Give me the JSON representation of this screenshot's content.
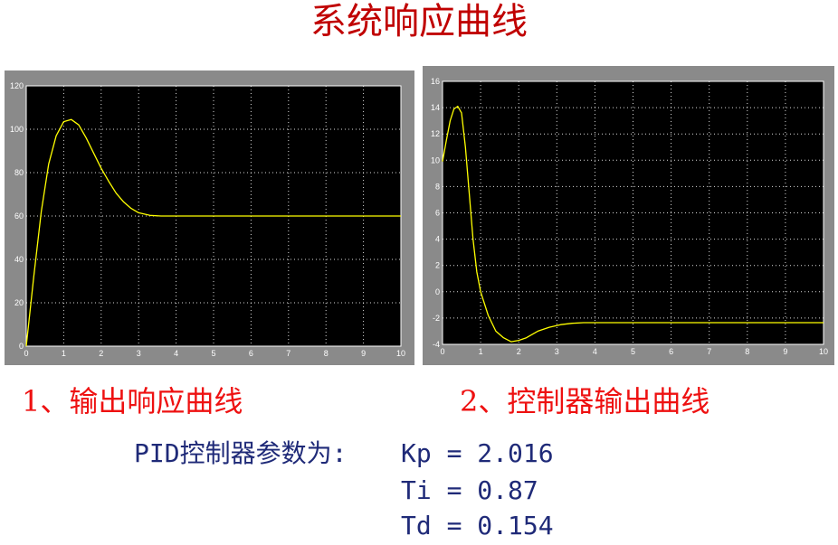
{
  "title": "系统响应曲线",
  "captions": {
    "chart1": "1、输出响应曲线",
    "chart2": "2、控制器输出曲线"
  },
  "params": {
    "label": "PID控制器参数为:",
    "kp": "Kp = 2.016",
    "ti": "Ti = 0.87",
    "td": "Td = 0.154"
  },
  "colors": {
    "plot_background": "#000000",
    "frame": "#8a8a8a",
    "grid": "#ffffff",
    "curve": "#ffff00",
    "caption": "#ee1111",
    "params": "#1f2a78"
  },
  "chart_data": [
    {
      "type": "line",
      "title": "",
      "xlabel": "",
      "ylabel": "",
      "xlim": [
        0,
        10
      ],
      "ylim": [
        0,
        120
      ],
      "xticks": [
        "0",
        "1",
        "2",
        "3",
        "4",
        "5",
        "6",
        "7",
        "8",
        "9",
        "10"
      ],
      "yticks": [
        "0",
        "20",
        "40",
        "60",
        "80",
        "100",
        "120"
      ],
      "grid": true,
      "series": [
        {
          "x": [
            0,
            0.2,
            0.4,
            0.6,
            0.8,
            1.0,
            1.2,
            1.4,
            1.6,
            1.8,
            2.0,
            2.2,
            2.4,
            2.6,
            2.8,
            3.0,
            3.3,
            3.6,
            4,
            5,
            6,
            7,
            8,
            9,
            10
          ],
          "y": [
            0,
            32,
            62,
            84,
            97,
            103.5,
            104.5,
            102,
            96,
            89,
            82,
            76,
            70.5,
            66.5,
            63.5,
            61.5,
            60.3,
            60,
            60,
            60,
            60,
            60,
            60,
            60,
            60
          ]
        }
      ]
    },
    {
      "type": "line",
      "title": "",
      "xlabel": "",
      "ylabel": "",
      "xlim": [
        0,
        10
      ],
      "ylim": [
        -4,
        16
      ],
      "xticks": [
        "0",
        "1",
        "2",
        "3",
        "4",
        "5",
        "6",
        "7",
        "8",
        "9",
        "10"
      ],
      "yticks": [
        "-4",
        "-2",
        "0",
        "2",
        "4",
        "6",
        "8",
        "10",
        "12",
        "14",
        "16"
      ],
      "grid": true,
      "series": [
        {
          "x": [
            0,
            0.1,
            0.2,
            0.3,
            0.4,
            0.5,
            0.6,
            0.7,
            0.8,
            0.9,
            1.0,
            1.2,
            1.4,
            1.6,
            1.8,
            2.0,
            2.2,
            2.5,
            2.8,
            3.1,
            3.4,
            3.7,
            4,
            5,
            6,
            7,
            8,
            9,
            10
          ],
          "y": [
            9.9,
            11.5,
            13.0,
            13.9,
            14.1,
            13.6,
            11.0,
            7.5,
            4.0,
            1.5,
            0.0,
            -1.8,
            -3.0,
            -3.5,
            -3.8,
            -3.7,
            -3.5,
            -3.0,
            -2.7,
            -2.5,
            -2.4,
            -2.35,
            -2.35,
            -2.35,
            -2.35,
            -2.35,
            -2.35,
            -2.35,
            -2.35
          ]
        }
      ]
    }
  ]
}
